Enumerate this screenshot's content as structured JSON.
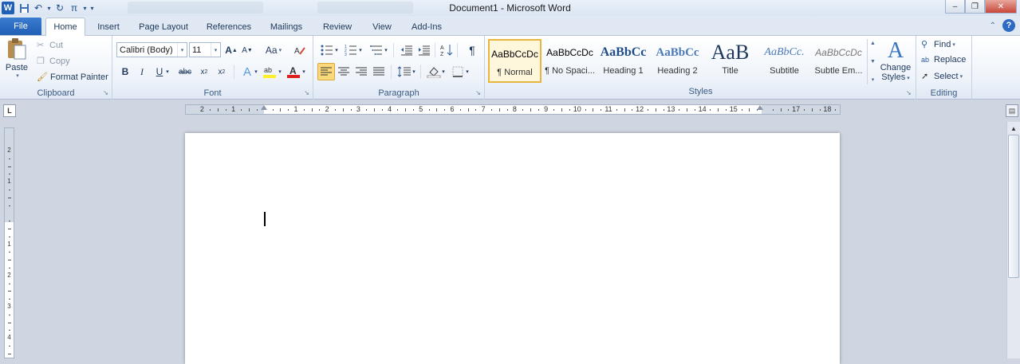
{
  "window": {
    "title": "Document1 - Microsoft Word",
    "ghost_tabs": [
      "",
      ""
    ]
  },
  "qat": {
    "icons": [
      "word-icon",
      "save-icon",
      "undo-icon",
      "redo-icon",
      "equation-icon",
      "customize-icon"
    ],
    "word_glyph": "W",
    "pi_glyph": "π"
  },
  "tabs": {
    "file": "File",
    "items": [
      "Home",
      "Insert",
      "Page Layout",
      "References",
      "Mailings",
      "Review",
      "View",
      "Add-Ins"
    ],
    "active": "Home"
  },
  "clipboard": {
    "paste": "Paste",
    "cut": "Cut",
    "copy": "Copy",
    "format_painter": "Format Painter",
    "label": "Clipboard"
  },
  "font": {
    "name": "Calibri (Body)",
    "size": "11",
    "label": "Font",
    "bold": "B",
    "italic": "I",
    "underline": "U",
    "strike": "abc",
    "grow": "A",
    "shrink": "A",
    "case": "Aa",
    "highlight_color": "#ffef2a",
    "font_color": "#e02020"
  },
  "paragraph": {
    "label": "Paragraph",
    "pilcrow": "¶"
  },
  "styles": {
    "label": "Styles",
    "items": [
      {
        "sample": "AaBbCcDc",
        "name": "¶ Normal"
      },
      {
        "sample": "AaBbCcDc",
        "name": "¶ No Spaci..."
      },
      {
        "sample": "AaBbCc",
        "name": "Heading 1"
      },
      {
        "sample": "AaBbCc",
        "name": "Heading 2"
      },
      {
        "sample": "AaB",
        "name": "Title"
      },
      {
        "sample": "AaBbCc.",
        "name": "Subtitle"
      },
      {
        "sample": "AaBbCcDc",
        "name": "Subtle Em..."
      }
    ],
    "change_styles": [
      "Change",
      "Styles"
    ],
    "change_glyph": "A"
  },
  "editing": {
    "label": "Editing",
    "find": "Find",
    "replace": "Replace",
    "select": "Select"
  },
  "ruler": {
    "toggle": "L",
    "numbers": [
      "2",
      "1",
      "",
      "1",
      "2",
      "3",
      "4",
      "5",
      "6",
      "7",
      "8",
      "9",
      "10",
      "11",
      "12",
      "13",
      "14",
      "15",
      "",
      "17",
      "18"
    ],
    "vnumbers": [
      "2",
      "1",
      "",
      "1",
      "2",
      "3",
      "4"
    ]
  }
}
